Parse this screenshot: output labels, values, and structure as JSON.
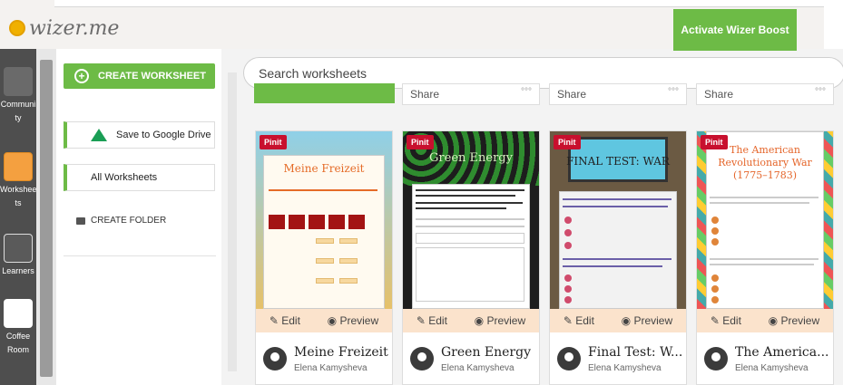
{
  "app": {
    "logo_text": "wizer.me",
    "boost_button": "Activate Wizer Boost"
  },
  "rail": {
    "items": [
      {
        "label": "Communi\nty",
        "icon": "community-icon"
      },
      {
        "label": "Workshee\nts",
        "icon": "worksheets-icon"
      },
      {
        "label": "Learners",
        "icon": "learners-icon"
      },
      {
        "label": "Coffee\nRoom",
        "icon": "coffee-icon"
      }
    ]
  },
  "left": {
    "create_worksheet": "CREATE WORKSHEET",
    "save_to_drive": "Save to Google Drive",
    "all_worksheets": "All Worksheets",
    "create_folder": "CREATE FOLDER"
  },
  "search": {
    "placeholder": "Search worksheets"
  },
  "prev_row": {
    "share_label": "Share",
    "more_label": "°°°"
  },
  "cards": [
    {
      "title": "Meine Freizeit",
      "author": "Elena Kamysheva",
      "thumb_title": "Meine Freizeit",
      "pin": "Pinit",
      "edit": "Edit",
      "preview": "Preview"
    },
    {
      "title": "Green Energy",
      "author": "Elena Kamysheva",
      "thumb_title": "Green Energy",
      "pin": "Pinit",
      "edit": "Edit",
      "preview": "Preview"
    },
    {
      "title": "Final Test: W...",
      "author": "Elena Kamysheva",
      "thumb_title": "FINAL TEST: WAR",
      "pin": "Pinit",
      "edit": "Edit",
      "preview": "Preview"
    },
    {
      "title": "The America...",
      "author": "Elena Kamysheva",
      "thumb_title": "The American Revolutionary War (1775–1783)",
      "pin": "Pinit",
      "edit": "Edit",
      "preview": "Preview"
    }
  ]
}
